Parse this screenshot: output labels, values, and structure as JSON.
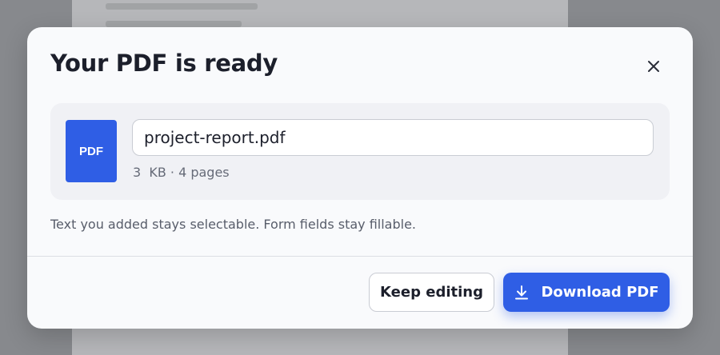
{
  "background": {
    "lines": [
      "",
      ""
    ]
  },
  "dialog": {
    "title": "Your PDF is ready",
    "close_icon": "close-icon",
    "file": {
      "thumb_label": "PDF",
      "filename": "project-report.pdf",
      "meta": "3  KB · 4 pages"
    },
    "note": "Text you added stays selectable. Form fields stay fillable.",
    "actions": {
      "keep_editing_label": "Keep editing",
      "download_label": "Download PDF",
      "download_icon": "download-icon"
    }
  },
  "colors": {
    "accent": "#2f5ee5",
    "title": "#1c1f2b",
    "muted": "#666b78",
    "surface": "#f9fafc",
    "card": "#f0f1f5",
    "overlay": "#8f9195"
  }
}
